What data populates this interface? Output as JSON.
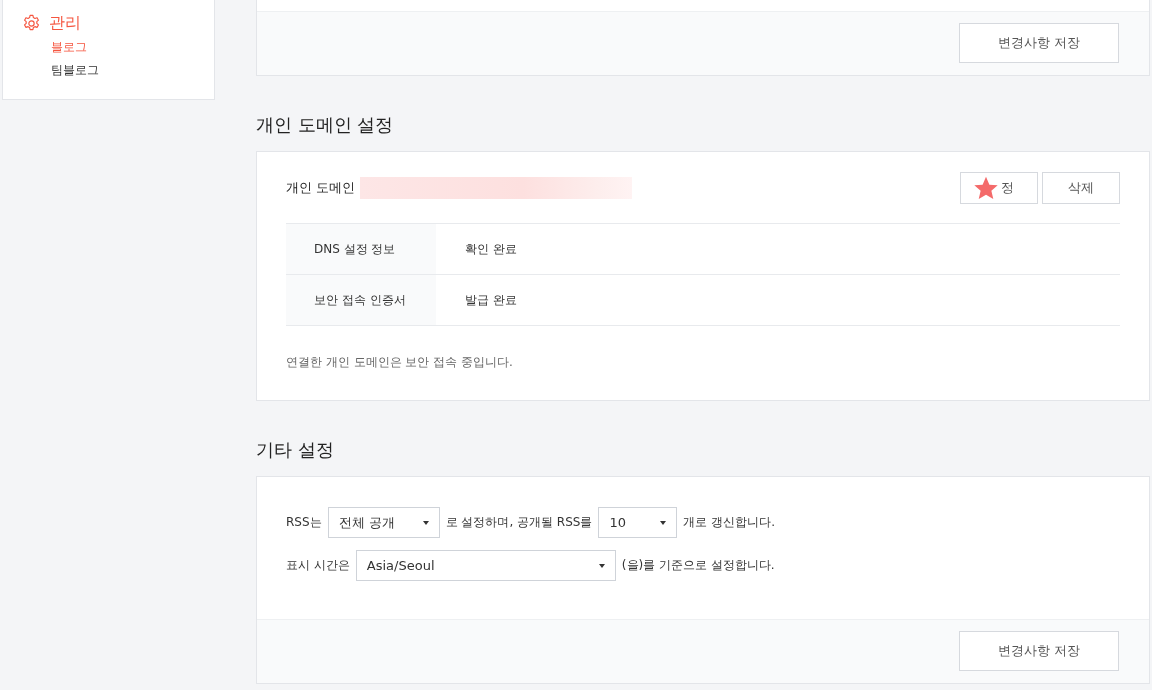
{
  "sidebar": {
    "title": "관리",
    "items": [
      {
        "label": "블로그",
        "selected": true
      },
      {
        "label": "팀블로그",
        "selected": false
      }
    ]
  },
  "top_card": {
    "save_button": "변경사항 저장"
  },
  "domain_section": {
    "heading": "개인 도메인 설정",
    "domain_label": "개인 도메인",
    "buttons": [
      "정",
      "삭제"
    ],
    "info_rows": [
      {
        "label": "DNS 설정 정보",
        "value": "확인 완료"
      },
      {
        "label": "보안 접속 인증서",
        "value": "발급 완료"
      }
    ],
    "note": "연결한 개인 도메인은 보안 접속 중입니다."
  },
  "other_section": {
    "heading": "기타 설정",
    "lines": [
      [
        {
          "kind": "text",
          "text": "RSS는"
        },
        {
          "kind": "select",
          "value": "전체 공개"
        },
        {
          "kind": "text",
          "text": "로 설정하며, 공개될 RSS를"
        },
        {
          "kind": "select",
          "value": "10"
        },
        {
          "kind": "text",
          "text": "개로 갱신합니다."
        }
      ],
      [
        {
          "kind": "text",
          "text": "표시 시간은"
        },
        {
          "kind": "select",
          "value": "Asia/Seoul"
        },
        {
          "kind": "text",
          "text": "(을)를 기준으로 설정합니다."
        }
      ]
    ],
    "save_button": "변경사항 저장"
  }
}
